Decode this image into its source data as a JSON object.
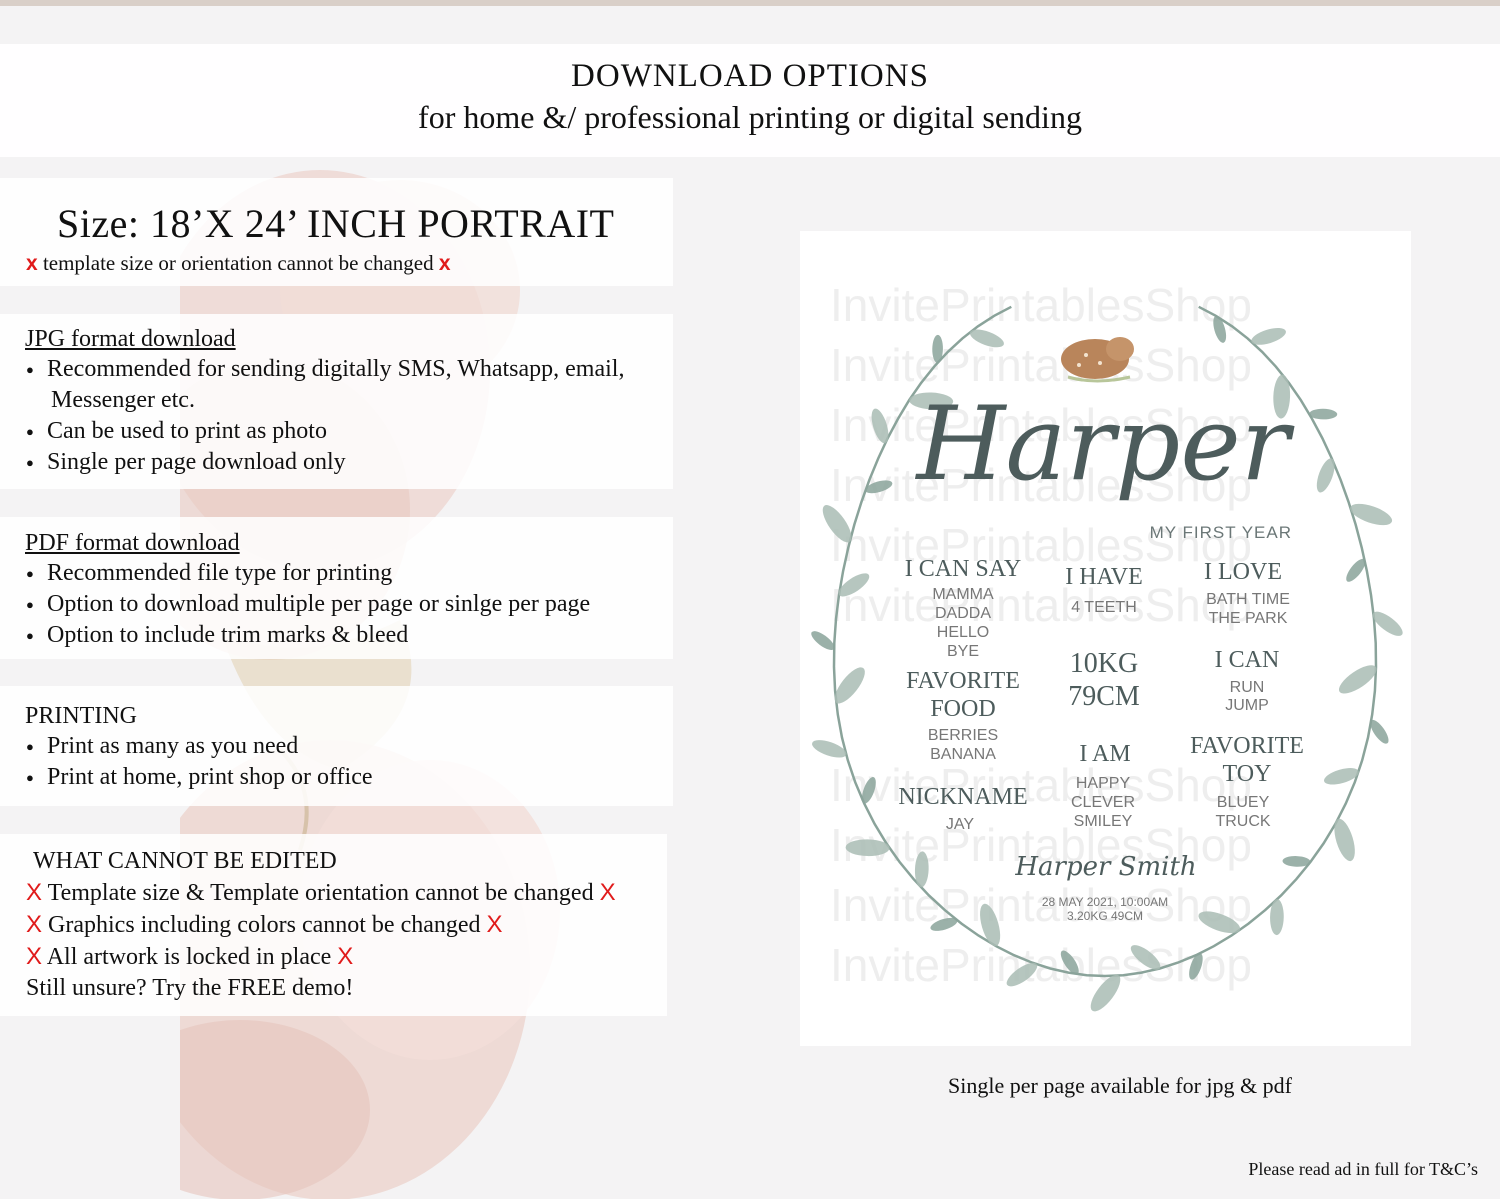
{
  "header": {
    "title": "DOWNLOAD OPTIONS",
    "subtitle": "for home &/ professional printing or digital sending"
  },
  "size": {
    "title": "Size: 18’X 24’ INCH PORTRAIT",
    "mark": "x",
    "note": "template size or orientation cannot be changed"
  },
  "jpg": {
    "title": "JPG format download",
    "items": [
      "Recommended for sending digitally SMS, Whatsapp, email,",
      "Messenger etc.",
      "Can be used to print as photo",
      "Single per page download only"
    ]
  },
  "pdf": {
    "title": "PDF format download",
    "items": [
      "Recommended file type for printing",
      "Option to download multiple per page or sinlge per page",
      "Option to include trim marks & bleed"
    ]
  },
  "printing": {
    "title": "PRINTING",
    "items": [
      "Print as many as you need",
      "Print at home, print shop or office"
    ]
  },
  "edit": {
    "title": "WHAT CANNOT BE EDITED",
    "mark": "X",
    "items": [
      "Template size & Template orientation cannot be changed",
      "Graphics including colors cannot be changed",
      "All artwork is locked in place"
    ],
    "closing": "Still unsure? Try the FREE demo!"
  },
  "poster": {
    "watermark": "InvitePrintablesShop",
    "name": "Harper",
    "subtitle": "MY FIRST YEAR",
    "blocks": {
      "say_title": "I CAN SAY",
      "say_lines": [
        "MAMMA",
        "DADDA",
        "HELLO",
        "BYE"
      ],
      "have_title": "I HAVE",
      "have_lines": [
        "4 TEETH"
      ],
      "love_title": "I LOVE",
      "love_lines": [
        "BATH TIME",
        "THE PARK"
      ],
      "food_title_1": "FAVORITE",
      "food_title_2": "FOOD",
      "food_lines": [
        "BERRIES",
        "BANANA"
      ],
      "weight": "10KG",
      "height": "79CM",
      "can_title": "I CAN",
      "can_lines": [
        "RUN",
        "JUMP"
      ],
      "am_title": "I AM",
      "am_lines": [
        "HAPPY",
        "CLEVER",
        "SMILEY"
      ],
      "toy_title_1": "FAVORITE",
      "toy_title_2": "TOY",
      "toy_lines": [
        "BLUEY",
        "TRUCK"
      ],
      "nick_title": "NICKNAME",
      "nick_lines": [
        "JAY"
      ]
    },
    "full_name": "Harper Smith",
    "birth_line_1": "28 MAY 2021, 10:00AM",
    "birth_line_2": "3.20KG 49CM",
    "colors": {
      "ink": "#4d5c5c",
      "leaf": "#a9bcb4",
      "leaf_dark": "#8aa39a"
    }
  },
  "caption": "Single per page available for jpg & pdf",
  "footnote": "Please read ad in full for T&C’s"
}
